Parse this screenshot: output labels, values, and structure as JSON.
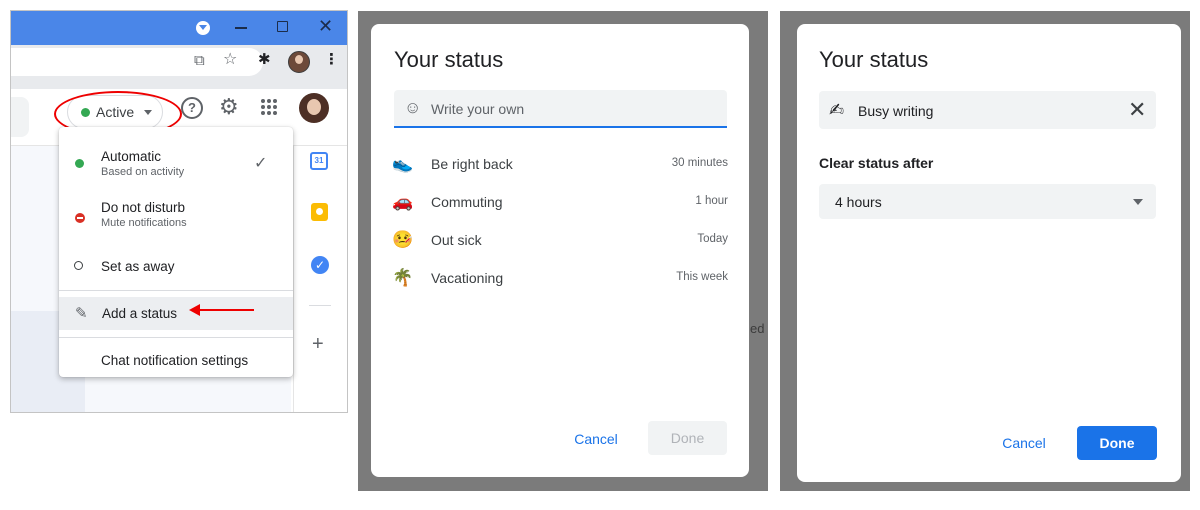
{
  "panel1": {
    "active_chip_label": "Active",
    "menu": {
      "items": [
        {
          "title": "Automatic",
          "subtitle": "Based on activity",
          "checked": true
        },
        {
          "title": "Do not disturb",
          "subtitle": "Mute notifications"
        },
        {
          "title": "Set as away"
        }
      ],
      "add_status": "Add a status",
      "settings": "Chat notification settings"
    },
    "calendar_day": "31"
  },
  "panel2": {
    "title": "Your status",
    "placeholder": "Write your own",
    "suggestions": [
      {
        "emoji": "👟",
        "label": "Be right back",
        "duration": "30 minutes"
      },
      {
        "emoji": "🚗",
        "label": "Commuting",
        "duration": "1 hour"
      },
      {
        "emoji": "🤒",
        "label": "Out sick",
        "duration": "Today"
      },
      {
        "emoji": "🌴",
        "label": "Vacationing",
        "duration": "This week"
      }
    ],
    "cancel": "Cancel",
    "done": "Done",
    "partial_bg_text": "ed"
  },
  "panel3": {
    "title": "Your status",
    "status_emoji": "✍",
    "status_text": "Busy writing",
    "clear_label": "Clear status after",
    "clear_value": "4 hours",
    "cancel": "Cancel",
    "done": "Done"
  },
  "colors": {
    "accent": "#1a73e8",
    "chrome_blue": "#4a86e8",
    "active_green": "#34a853",
    "dnd_red": "#d93025",
    "annotation_red": "#ee0000"
  }
}
